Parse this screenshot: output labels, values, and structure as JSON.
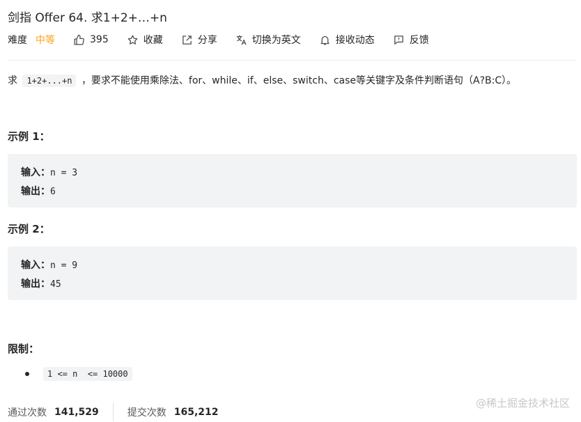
{
  "problem": {
    "title": "剑指 Offer 64. 求1+2+…+n"
  },
  "meta": {
    "difficulty_label": "难度",
    "difficulty_value": "中等",
    "likes": "395",
    "favorite_label": "收藏",
    "share_label": "分享",
    "translate_label": "切换为英文",
    "notify_label": "接收动态",
    "feedback_label": "反馈",
    "icons": [
      "thumbs-up-icon",
      "star-icon",
      "share-icon",
      "translate-icon",
      "bell-icon",
      "feedback-icon"
    ]
  },
  "description": {
    "prefix": "求",
    "code": "1+2+...+n",
    "suffix": "，要求不能使用乘除法、for、while、if、else、switch、case等关键字及条件判断语句（A?B:C）。"
  },
  "examples": [
    {
      "title": "示例 1：",
      "input_label": "输入：",
      "input_value": "n = 3",
      "output_label": "输出：",
      "output_value": "6"
    },
    {
      "title": "示例 2：",
      "input_label": "输入：",
      "input_value": "n = 9",
      "output_label": "输出：",
      "output_value": "45"
    }
  ],
  "limits": {
    "title": "限制：",
    "items": [
      "1 <= n  <= 10000"
    ]
  },
  "footer": {
    "accepted_label": "通过次数",
    "accepted_value": "141,529",
    "submitted_label": "提交次数",
    "submitted_value": "165,212"
  },
  "watermark": "@稀土掘金技术社区",
  "colors": {
    "difficulty_medium": "#ffa116",
    "code_background": "#f2f3f5",
    "text": "#262626"
  }
}
